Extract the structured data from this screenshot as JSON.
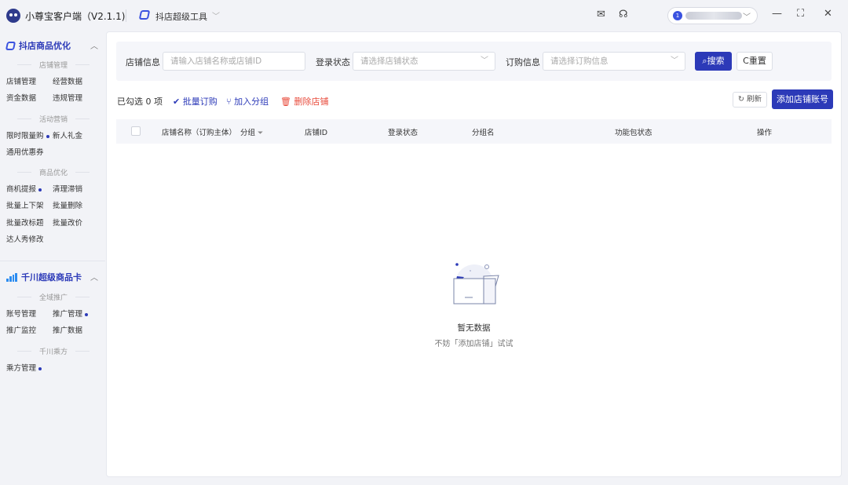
{
  "titlebar": {
    "app_title": "小尊宝客户端（V2.1.1)",
    "tool_name": "抖店超级工具",
    "user_badge": "1"
  },
  "sidebar": {
    "section1": {
      "title": "抖店商品优化",
      "groups": [
        {
          "label": "店铺管理",
          "items": [
            {
              "label": "店铺管理",
              "dot": false
            },
            {
              "label": "经营数据",
              "dot": false
            },
            {
              "label": "资金数据",
              "dot": false
            },
            {
              "label": "违规管理",
              "dot": false
            }
          ]
        },
        {
          "label": "活动营销",
          "items": [
            {
              "label": "限时限量购",
              "dot": true
            },
            {
              "label": "新人礼金",
              "dot": false
            },
            {
              "label": "通用优惠券",
              "dot": false
            }
          ]
        },
        {
          "label": "商品优化",
          "items": [
            {
              "label": "商机提报",
              "dot": true
            },
            {
              "label": "清理滞销",
              "dot": false
            },
            {
              "label": "批量上下架",
              "dot": false
            },
            {
              "label": "批量删除",
              "dot": false
            },
            {
              "label": "批量改标题",
              "dot": false
            },
            {
              "label": "批量改价",
              "dot": false
            },
            {
              "label": "达人秀修改",
              "dot": false
            }
          ]
        }
      ]
    },
    "section2": {
      "title": "千川超级商品卡",
      "groups": [
        {
          "label": "全域推广",
          "items": [
            {
              "label": "账号管理",
              "dot": false
            },
            {
              "label": "推广管理",
              "dot": true
            },
            {
              "label": "推广监控",
              "dot": false
            },
            {
              "label": "推广数据",
              "dot": false
            }
          ]
        },
        {
          "label": "千川乘方",
          "items": [
            {
              "label": "乘方管理",
              "dot": true
            }
          ]
        }
      ]
    }
  },
  "filters": {
    "shop_label": "店铺信息",
    "shop_placeholder": "请输入店铺名称或店铺ID",
    "login_label": "登录状态",
    "login_placeholder": "请选择店铺状态",
    "order_label": "订购信息",
    "order_placeholder": "请选择订购信息",
    "search_label": "搜索",
    "reset_label": "重置"
  },
  "toolbar": {
    "selected_prefix": "已勾选",
    "selected_count": "0",
    "selected_suffix": "项",
    "bulk_order": "批量订购",
    "add_group": "加入分组",
    "delete_shop": "删除店铺",
    "refresh": "刷新",
    "add_shop": "添加店铺账号"
  },
  "table": {
    "columns": [
      "店铺名称（订购主体）",
      "分组",
      "店铺ID",
      "登录状态",
      "分组名",
      "功能包状态",
      "操作"
    ]
  },
  "empty": {
    "title": "暂无数据",
    "subtitle": "不妨「添加店铺」试试"
  },
  "colors": {
    "primary": "#2c3ab8",
    "danger": "#e84b3c",
    "background": "#f2f3f7"
  }
}
